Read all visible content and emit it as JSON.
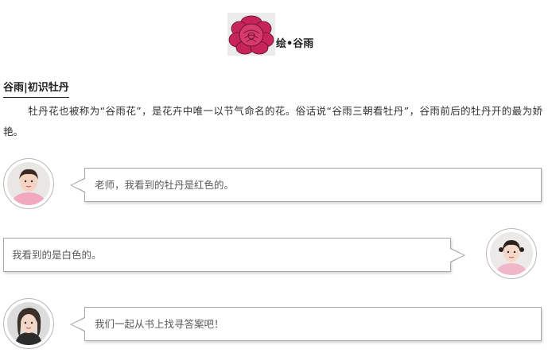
{
  "header": {
    "image_icon": "peony-flower-drawing",
    "title": "绘•谷雨"
  },
  "section": {
    "heading": "谷雨|初识牡丹",
    "intro": "牡丹花也被称为“谷雨花”，是花卉中唯一以节气命名的花。俗话说“谷雨三朝看牡丹”，谷雨前后的牡丹开的最为娇艳。"
  },
  "chat": [
    {
      "side": "left",
      "avatar_icon": "child-girl-avatar",
      "text": "老师，我看到的牡丹是红色的。"
    },
    {
      "side": "right",
      "avatar_icon": "child-girl-avatar",
      "text": "我看到的是白色的。"
    },
    {
      "side": "left",
      "avatar_icon": "teacher-woman-avatar",
      "text": "我们一起从书上找寻答案吧！"
    }
  ],
  "colors": {
    "bubble_border": "#a7a7a7",
    "bubble_text": "#5a5a5a",
    "body_text": "#333333",
    "heading_text": "#222222",
    "flower_petal": "#c8245c"
  }
}
